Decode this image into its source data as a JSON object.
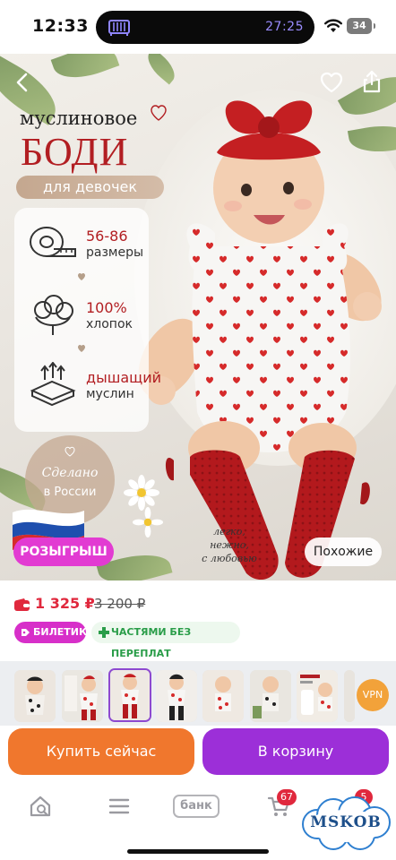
{
  "status_bar": {
    "time": "12:33",
    "island_timer": "27:25",
    "battery": "34",
    "island_timer_color": "#9a8cff"
  },
  "hero": {
    "title_small": "муслиновое",
    "title_big": "БОДИ",
    "title_pill": "для девочек",
    "features": [
      {
        "value": "56-86",
        "label": "размеры",
        "icon": "measuring-tape-icon"
      },
      {
        "value": "100%",
        "label": "хлопок",
        "icon": "cotton-icon"
      },
      {
        "value": "дышащий",
        "label": "муслин",
        "icon": "breathable-fabric-icon"
      }
    ],
    "made_in": {
      "line1": "Сделано",
      "line2": "в России"
    },
    "tagline": [
      "легко,",
      "нежно,",
      "с любовью"
    ],
    "promo_label": "РОЗЫГРЫШ",
    "similar_label": "Похожие",
    "accent_color": "#b21e22"
  },
  "price": {
    "current": "1 325 ₽",
    "old": "3 200 ₽",
    "chips": {
      "ticket": "БИЛЕТИК",
      "installments": "ЧАСТЯМИ БЕЗ ПЕРЕПЛАТ"
    },
    "price_color": "#e0283d"
  },
  "thumbnails": {
    "count_visible": 7,
    "selected_index": 2,
    "vpn_label": "VPN"
  },
  "actions": {
    "buy_now": "Купить сейчас",
    "add_to_cart": "В корзину",
    "buy_color": "#f0772d",
    "cart_color": "#9c2fd8"
  },
  "bottom_nav": {
    "bank_label": "банк",
    "cart_count": "67",
    "profile_count": "5"
  },
  "watermark": "MSKOB"
}
